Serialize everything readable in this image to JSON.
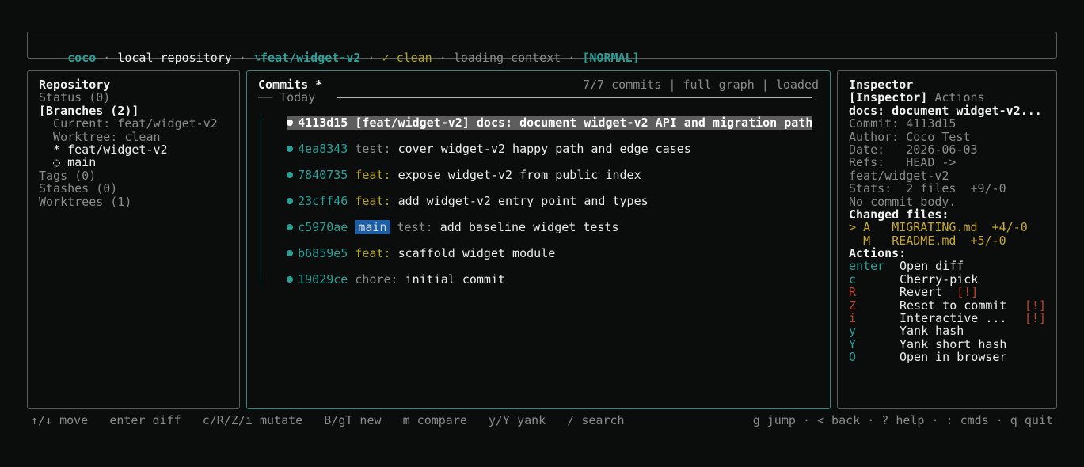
{
  "topbar": {
    "app": "coco",
    "sep": " · ",
    "repo": "local repository",
    "branch_icon": "⌥",
    "branch": "feat/widget-v2",
    "status_icon": "✓",
    "status": "clean",
    "loading": "loading context",
    "mode": "[NORMAL]"
  },
  "repo_panel": {
    "title": "Repository",
    "status": "Status (0)",
    "branches_header": "[Branches (2)]",
    "current": "  Current: feat/widget-v2",
    "worktree": "  Worktree: clean",
    "branch_items": [
      {
        "marker": "  * ",
        "name": "feat/widget-v2"
      },
      {
        "marker": "  ◌ ",
        "name": "main"
      }
    ],
    "tags": "Tags (0)",
    "stashes": "Stashes (0)",
    "worktrees": "Worktrees (1)"
  },
  "commits_panel": {
    "title": "Commits *",
    "summary": "7/7 commits | full graph | loaded",
    "group": "── Today",
    "commits": [
      {
        "hash": "4113d15",
        "ref": "[feat/widget-v2]",
        "type": "docs:",
        "message": "document widget-v2 API and migration path",
        "selected": true
      },
      {
        "hash": "4ea8343",
        "type": "test:",
        "message": "cover widget-v2 happy path and edge cases"
      },
      {
        "hash": "7840735",
        "type": "feat:",
        "message": "expose widget-v2 from public index"
      },
      {
        "hash": "23cff46",
        "type": "feat:",
        "message": "add widget-v2 entry point and types"
      },
      {
        "hash": "c5970ae",
        "badge": "main",
        "type": "test:",
        "message": "add baseline widget tests"
      },
      {
        "hash": "b6859e5",
        "type": "feat:",
        "message": "scaffold widget module"
      },
      {
        "hash": "19029ce",
        "type": "chore:",
        "message": "initial commit"
      }
    ]
  },
  "inspector_panel": {
    "title": "Inspector",
    "tab_active": "[Inspector]",
    "tab_other": "Actions",
    "subject": "docs: document widget-v2...",
    "commit": "Commit: 4113d15",
    "author": "Author: Coco Test",
    "date": "Date:   2026-06-03",
    "refs": "Refs:   HEAD ->",
    "refs2": "feat/widget-v2",
    "stats": "Stats:  2 files  +9/-0",
    "body": "No commit body.",
    "changed_header": "Changed files:",
    "files": [
      {
        "marker": "> ",
        "status": "A",
        "name": "MIGRATING.md",
        "delta": "+4/-0"
      },
      {
        "marker": "  ",
        "status": "M",
        "name": "README.md",
        "delta": "+5/-0"
      }
    ],
    "actions_header": "Actions:",
    "actions": [
      {
        "key": "enter",
        "label": "Open diff",
        "warn": ""
      },
      {
        "key": "c",
        "label": "Cherry-pick",
        "warn": ""
      },
      {
        "key": "R",
        "label": "Revert",
        "warn": "[!]"
      },
      {
        "key": "Z",
        "label": "Reset to commit",
        "warn": "[!]"
      },
      {
        "key": "i",
        "label": "Interactive ...",
        "warn": "[!]"
      },
      {
        "key": "y",
        "label": "Yank hash",
        "warn": ""
      },
      {
        "key": "Y",
        "label": "Yank short hash",
        "warn": ""
      },
      {
        "key": "O",
        "label": "Open in browser",
        "warn": ""
      }
    ]
  },
  "footer": {
    "left": "↑/↓ move   enter diff   c/R/Z/i mutate   B/gT new   m compare   y/Y yank   / search",
    "right": "g jump · < back · ? help · : cmds · q quit"
  },
  "colors": {
    "accent": "#2aa198",
    "selection": "#5d5d5d",
    "badge": "#1d5fa6",
    "warning": "#c0452c",
    "feat": "#b5a62a"
  }
}
